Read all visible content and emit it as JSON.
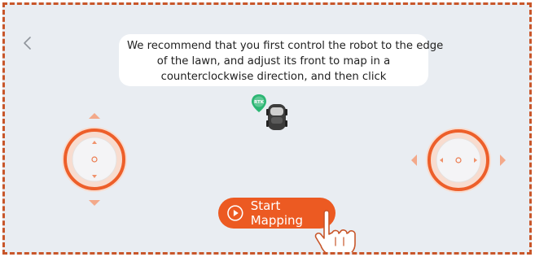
{
  "tip": {
    "line1": "We recommend that you first control the robot to the edge",
    "line2": "of the lawn, and adjust its front to map in a",
    "line3": "counterclockwise direction, and then click"
  },
  "robot": {
    "badge": "RTK"
  },
  "start_button": {
    "label": "Start Mapping"
  },
  "icons": {
    "back": "chevron-left-icon",
    "robot": "robot-mower-icon",
    "play": "play-circle-icon",
    "hand": "tap-hand-icon"
  },
  "colors": {
    "accent": "#ec5a22",
    "background": "#e9edf2",
    "border": "#c8562a",
    "rtk_badge": "#2bb673"
  }
}
